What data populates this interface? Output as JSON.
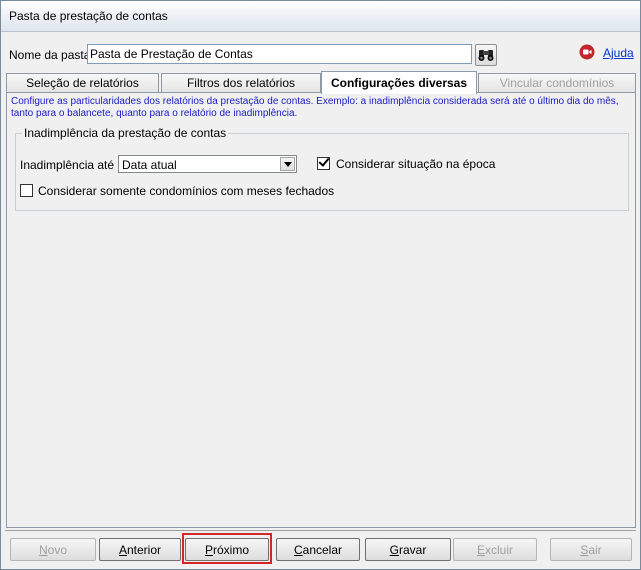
{
  "window": {
    "title": "Pasta de prestação de contas"
  },
  "header": {
    "name_label": "Nome da pasta:",
    "name_value": "Pasta de Prestação de Contas",
    "help_label": "Ajuda"
  },
  "tabs": [
    {
      "label": "Seleção de relatórios",
      "state": "normal"
    },
    {
      "label": "Filtros dos relatórios",
      "state": "normal"
    },
    {
      "label": "Configurações diversas",
      "state": "active"
    },
    {
      "label": "Vincular condomínios",
      "state": "disabled"
    }
  ],
  "panel": {
    "description": "Configure as particularidades dos relatórios da prestação de contas. Exemplo: a inadimplência considerada será até o último dia do mês, tanto para o balancete, quanto para o relatório de inadimplência.",
    "group_title": "Inadimplência da prestação de contas",
    "inad_label": "Inadimplência até",
    "inad_select_value": "Data atual",
    "check_epoca": {
      "label": "Considerar situação na época",
      "checked": true
    },
    "check_meses": {
      "label": "Considerar somente condomínios com meses fechados",
      "checked": false
    }
  },
  "buttons": [
    {
      "label": "Novo",
      "accel": "N",
      "rest": "ovo",
      "enabled": false
    },
    {
      "label": "Anterior",
      "accel": "A",
      "rest": "nterior",
      "enabled": true
    },
    {
      "label": "Próximo",
      "accel": "P",
      "rest": "róximo",
      "enabled": true,
      "highlighted": true
    },
    {
      "label": "Cancelar",
      "accel": "C",
      "rest": "ancelar",
      "enabled": true
    },
    {
      "label": "Gravar",
      "accel": "G",
      "rest": "ravar",
      "enabled": true
    },
    {
      "label": "Excluir",
      "accel": "E",
      "rest": "xcluir",
      "enabled": false
    },
    {
      "label": "Sair",
      "accel": "S",
      "rest": "air",
      "enabled": false
    }
  ],
  "colors": {
    "highlight": "#d32626",
    "description_text": "#1a1ac8",
    "link": "#0033cc",
    "help_icon": "#c0262b"
  }
}
